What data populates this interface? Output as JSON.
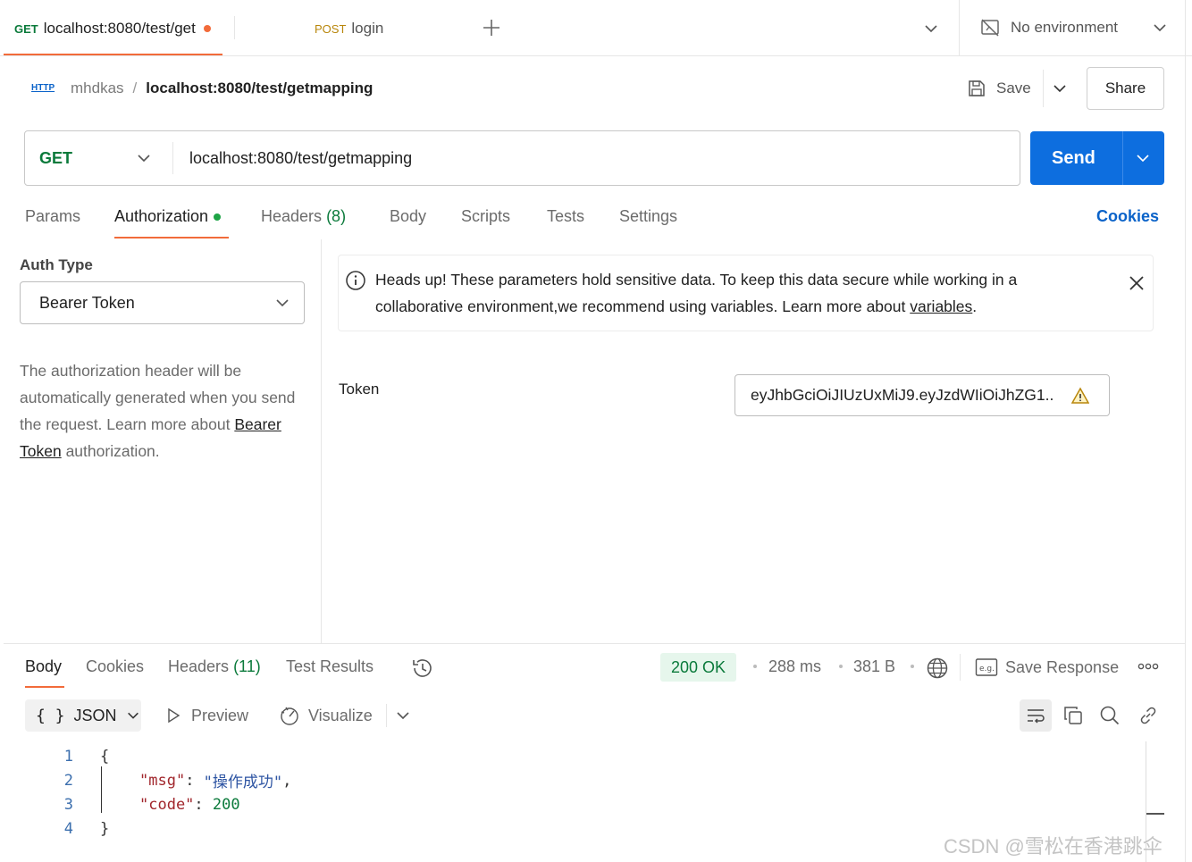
{
  "tabs": [
    {
      "method": "GET",
      "title": "localhost:8080/test/get"
    },
    {
      "method": "POST",
      "title": "login"
    }
  ],
  "environment": {
    "label": "No environment"
  },
  "breadcrumb": {
    "collection": "mhdkas",
    "separator": "/",
    "request": "localhost:8080/test/getmapping",
    "icon_text": "HTTP"
  },
  "actions": {
    "save_label": "Save",
    "share_label": "Share"
  },
  "request": {
    "method": "GET",
    "url": "localhost:8080/test/getmapping",
    "send_label": "Send"
  },
  "req_tabs": {
    "params": "Params",
    "authorization": "Authorization",
    "headers": "Headers",
    "headers_count": "(8)",
    "body": "Body",
    "scripts": "Scripts",
    "tests": "Tests",
    "settings": "Settings",
    "cookies": "Cookies"
  },
  "auth": {
    "type_label": "Auth Type",
    "type_value": "Bearer Token",
    "desc": "The authorization header will be automatically generated when you send the request. Learn more about",
    "desc_link": "Bearer Token",
    "desc_suffix": "authorization.",
    "notice": "Heads up! These parameters hold sensitive data. To keep this data secure while working in a collaborative environment,we recommend using variables. Learn more about",
    "notice_link": "variables",
    "notice_end": ".",
    "token_label": "Token",
    "token_value": "eyJhbGciOiJIUzUxMiJ9.eyJzdWIiOiJhZG1.."
  },
  "response": {
    "tabs": {
      "body": "Body",
      "cookies": "Cookies",
      "headers": "Headers",
      "headers_count": "(11)",
      "test_results": "Test Results"
    },
    "status": "200 OK",
    "time": "288 ms",
    "size": "381 B",
    "save_response": "Save Response",
    "format": "JSON",
    "format_icon": "{ }",
    "preview": "Preview",
    "visualize": "Visualize",
    "code_lines": [
      {
        "n": "1",
        "text": "{"
      },
      {
        "n": "2",
        "key": "\"msg\"",
        "sep": ": ",
        "val": "\"操作成功\"",
        "end": ","
      },
      {
        "n": "3",
        "key": "\"code\"",
        "sep": ": ",
        "num": "200"
      },
      {
        "n": "4",
        "text": "}"
      }
    ]
  },
  "watermark": "CSDN @雪松在香港跳伞",
  "colors": {
    "accent": "#f26b3a",
    "send": "#0d6edf",
    "get": "#0b7a3b",
    "post": "#b8860b",
    "status_bg": "#e6f6ec",
    "link": "#0b63c9"
  }
}
